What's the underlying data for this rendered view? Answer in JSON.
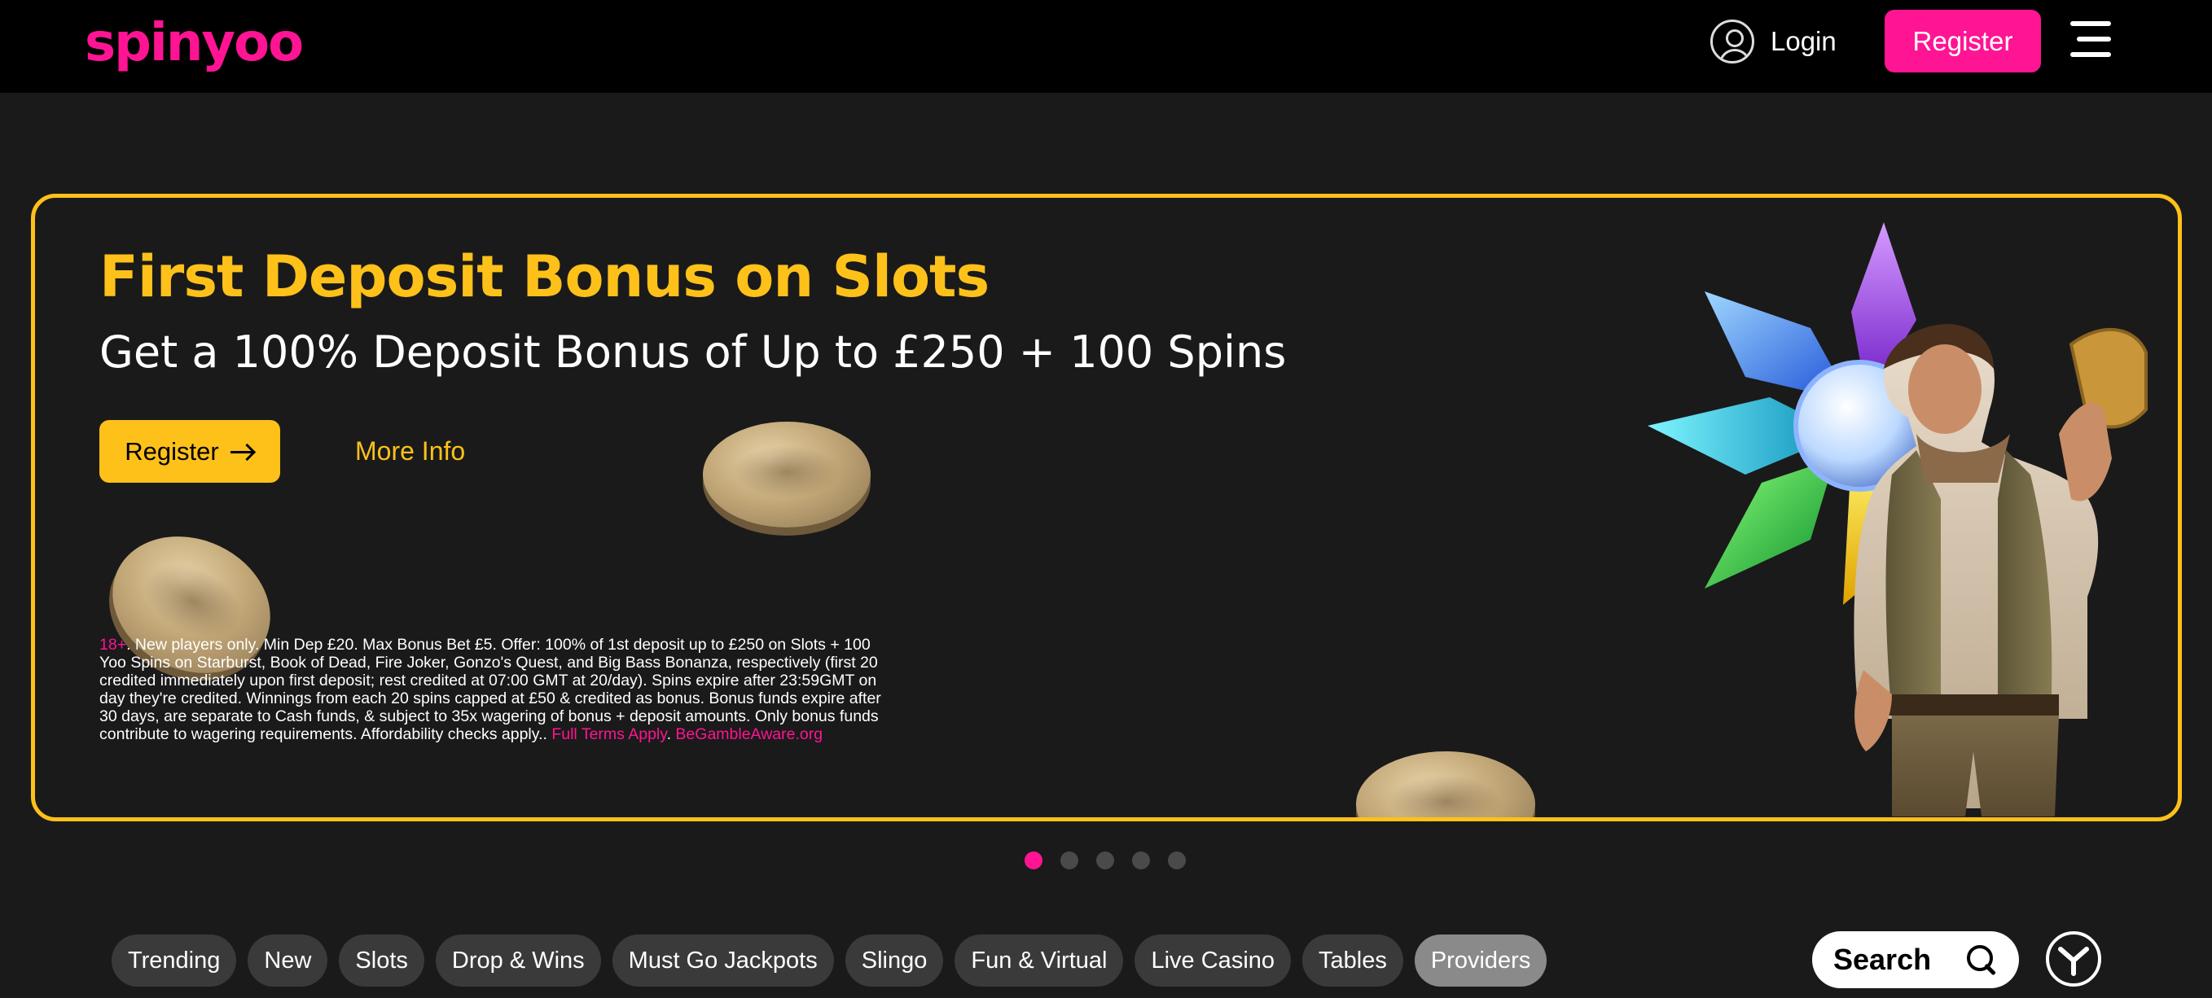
{
  "header": {
    "logo": "spinyoo",
    "login_label": "Login",
    "register_label": "Register"
  },
  "banner": {
    "title": "First Deposit Bonus on Slots",
    "subtitle": "Get a 100% Deposit Bonus of Up to £250 + 100 Spins",
    "register_label": "Register",
    "more_info_label": "More Info",
    "terms": {
      "age": "18+",
      "body": ". New players only. Min Dep £20. Max Bonus Bet £5. Offer: 100% of 1st deposit up to £250 on Slots + 100 Yoo Spins on Starburst, Book of Dead, Fire Joker, Gonzo's Quest, and Big Bass Bonanza, respectively (first 20 credited immediately upon first deposit; rest credited at 07:00 GMT at 20/day). Spins expire after 23:59GMT on day they're credited. Winnings from each 20 spins capped at £50 & credited as bonus. Bonus funds expire after 30 days, are separate to Cash funds, & subject to 35x wagering of bonus + deposit amounts. Only bonus funds contribute to wagering requirements. Affordability checks apply.. ",
      "full_terms_link": "Full Terms Apply",
      "separator": ". ",
      "gamble_aware_link": "BeGambleAware.org"
    }
  },
  "carousel": {
    "slide_count": 5,
    "active_index": 0
  },
  "categories": [
    {
      "label": "Trending"
    },
    {
      "label": "New"
    },
    {
      "label": "Slots"
    },
    {
      "label": "Drop & Wins"
    },
    {
      "label": "Must Go Jackpots"
    },
    {
      "label": "Slingo"
    },
    {
      "label": "Fun & Virtual"
    },
    {
      "label": "Live Casino"
    },
    {
      "label": "Tables"
    },
    {
      "label": "Providers"
    }
  ],
  "active_category": "Providers",
  "search": {
    "label": "Search"
  },
  "colors": {
    "brand_pink": "#ff1493",
    "accent_yellow": "#fdc11a",
    "header_bg": "#000000",
    "page_bg": "#1a1a1a"
  },
  "icons": [
    "user-icon",
    "menu-icon",
    "arrow-right-icon",
    "search-icon",
    "yoo-logo-icon"
  ]
}
